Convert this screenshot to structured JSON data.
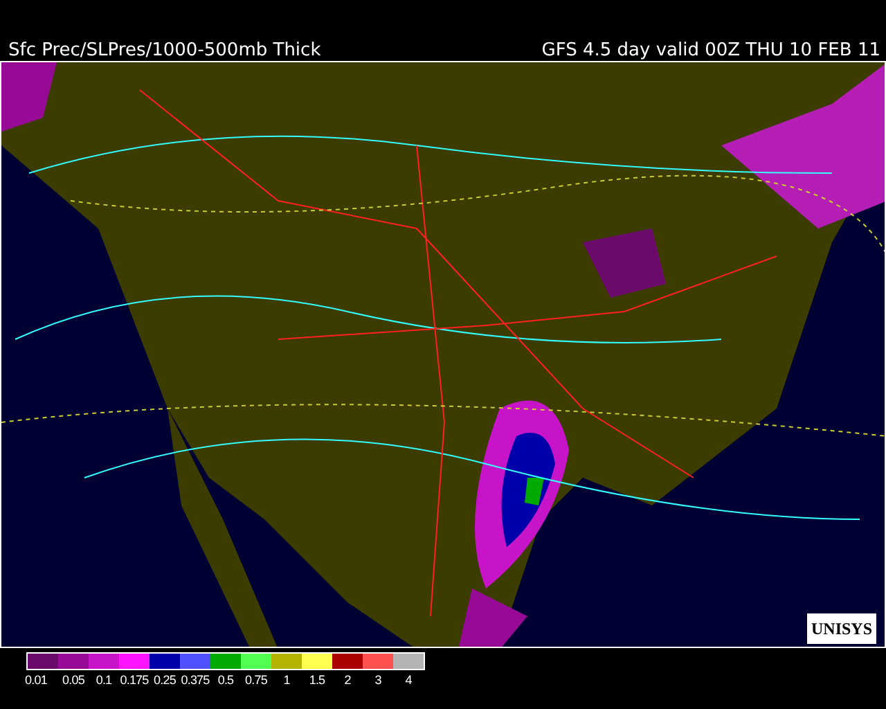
{
  "header": {
    "title": "Sfc Prec/SLPres/1000-500mb Thick",
    "valid": "GFS 4.5 day valid 00Z THU 10 FEB 11"
  },
  "map": {
    "logo": "UNISYS"
  },
  "legend": {
    "bins": [
      {
        "color": "#6a0a6a"
      },
      {
        "color": "#960a96"
      },
      {
        "color": "#c814c8"
      },
      {
        "color": "#ff14ff"
      },
      {
        "color": "#0000aa"
      },
      {
        "color": "#5050ff"
      },
      {
        "color": "#00aa00"
      },
      {
        "color": "#50ff50"
      },
      {
        "color": "#b4b400"
      },
      {
        "color": "#ffff50"
      },
      {
        "color": "#aa0000"
      },
      {
        "color": "#ff5050"
      },
      {
        "color": "#b4b4b4"
      }
    ],
    "labels": [
      "0.01",
      "0.05",
      "0.1",
      "0.175",
      "0.25",
      "0.375",
      "0.5",
      "0.75",
      "1",
      "1.5",
      "2",
      "3",
      "4"
    ]
  }
}
